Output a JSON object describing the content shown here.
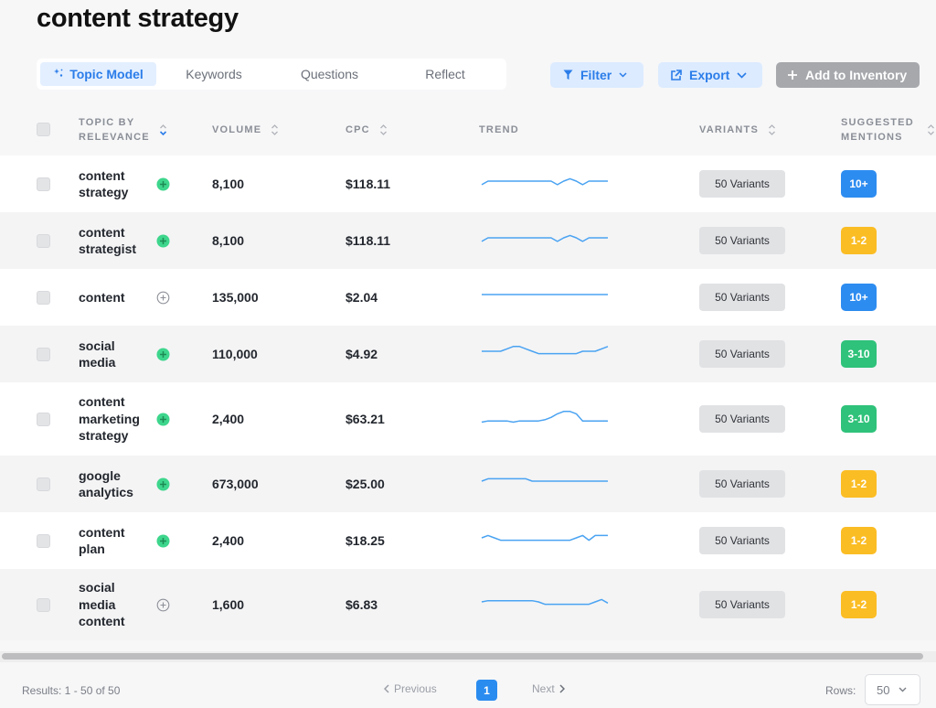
{
  "page": {
    "title": "content strategy"
  },
  "tabs": [
    {
      "label": "Topic Model",
      "active": true
    },
    {
      "label": "Keywords",
      "active": false
    },
    {
      "label": "Questions",
      "active": false
    },
    {
      "label": "Reflect",
      "active": false
    }
  ],
  "toolbar": {
    "filter_label": "Filter",
    "export_label": "Export",
    "add_label": "Add to Inventory"
  },
  "columns": {
    "topic": [
      "TOPIC BY",
      "RELEVANCE"
    ],
    "volume": "VOLUME",
    "cpc": "CPC",
    "trend": "TREND",
    "variants": "VARIANTS",
    "mentions": [
      "SUGGESTED",
      "MENTIONS"
    ]
  },
  "colors": {
    "accent": "#2b7de9",
    "trend_line": "#4aa3f2",
    "badge_blue": "#2d8cf0",
    "badge_yellow": "#fbbd24",
    "badge_green": "#2fc27a",
    "plus_green": "#3dd68c"
  },
  "rows": [
    {
      "keyword": [
        "content",
        "strategy"
      ],
      "added": true,
      "volume": "8,100",
      "cpc": "$118.11",
      "trend": [
        7,
        10,
        10,
        10,
        10,
        10,
        10,
        10,
        10,
        10,
        10,
        10,
        7,
        10,
        12,
        10,
        7,
        10,
        10,
        10,
        10
      ],
      "variants": "50 Variants",
      "mentions": "10+",
      "mentions_color": "blue"
    },
    {
      "keyword": [
        "content",
        "strategist"
      ],
      "added": true,
      "volume": "8,100",
      "cpc": "$118.11",
      "trend": [
        7,
        10,
        10,
        10,
        10,
        10,
        10,
        10,
        10,
        10,
        10,
        10,
        7,
        10,
        12,
        10,
        7,
        10,
        10,
        10,
        10
      ],
      "variants": "50 Variants",
      "mentions": "1-2",
      "mentions_color": "yellow"
    },
    {
      "keyword": [
        "content"
      ],
      "added": false,
      "volume": "135,000",
      "cpc": "$2.04",
      "trend": [
        10,
        10,
        10,
        10,
        10,
        10,
        10,
        10,
        10,
        10,
        10,
        10,
        10,
        10,
        10,
        10,
        10,
        10,
        10,
        10,
        10
      ],
      "variants": "50 Variants",
      "mentions": "10+",
      "mentions_color": "blue"
    },
    {
      "keyword": [
        "social",
        "media"
      ],
      "added": true,
      "volume": "110,000",
      "cpc": "$4.92",
      "trend": [
        10,
        10,
        10,
        10,
        12,
        14,
        14,
        12,
        10,
        8,
        8,
        8,
        8,
        8,
        8,
        8,
        10,
        10,
        10,
        12,
        14
      ],
      "variants": "50 Variants",
      "mentions": "3-10",
      "mentions_color": "green"
    },
    {
      "keyword": [
        "content",
        "marketing",
        "strategy"
      ],
      "added": true,
      "volume": "2,400",
      "cpc": "$63.21",
      "trend": [
        5,
        6,
        6,
        6,
        6,
        5,
        6,
        6,
        6,
        6,
        7,
        9,
        12,
        14,
        14,
        12,
        6,
        6,
        6,
        6,
        6
      ],
      "variants": "50 Variants",
      "mentions": "3-10",
      "mentions_color": "green"
    },
    {
      "keyword": [
        "google",
        "analytics"
      ],
      "added": true,
      "volume": "673,000",
      "cpc": "$25.00",
      "trend": [
        10,
        12,
        12,
        12,
        12,
        12,
        12,
        12,
        10,
        10,
        10,
        10,
        10,
        10,
        10,
        10,
        10,
        10,
        10,
        10,
        10
      ],
      "variants": "50 Variants",
      "mentions": "1-2",
      "mentions_color": "yellow"
    },
    {
      "keyword": [
        "content",
        "plan"
      ],
      "added": true,
      "volume": "2,400",
      "cpc": "$18.25",
      "trend": [
        10,
        12,
        10,
        8,
        8,
        8,
        8,
        8,
        8,
        8,
        8,
        8,
        8,
        8,
        8,
        10,
        12,
        8,
        12,
        12,
        12
      ],
      "variants": "50 Variants",
      "mentions": "1-2",
      "mentions_color": "yellow"
    },
    {
      "keyword": [
        "social",
        "media",
        "content"
      ],
      "added": false,
      "volume": "1,600",
      "cpc": "$6.83",
      "trend": [
        10,
        11,
        11,
        11,
        11,
        11,
        11,
        11,
        11,
        10,
        8,
        8,
        8,
        8,
        8,
        8,
        8,
        8,
        10,
        12,
        9
      ],
      "variants": "50 Variants",
      "mentions": "1-2",
      "mentions_color": "yellow"
    }
  ],
  "footer": {
    "results": "Results: 1 - 50 of 50",
    "previous": "Previous",
    "page": "1",
    "next": "Next",
    "rows_label": "Rows:",
    "rows_value": "50"
  }
}
